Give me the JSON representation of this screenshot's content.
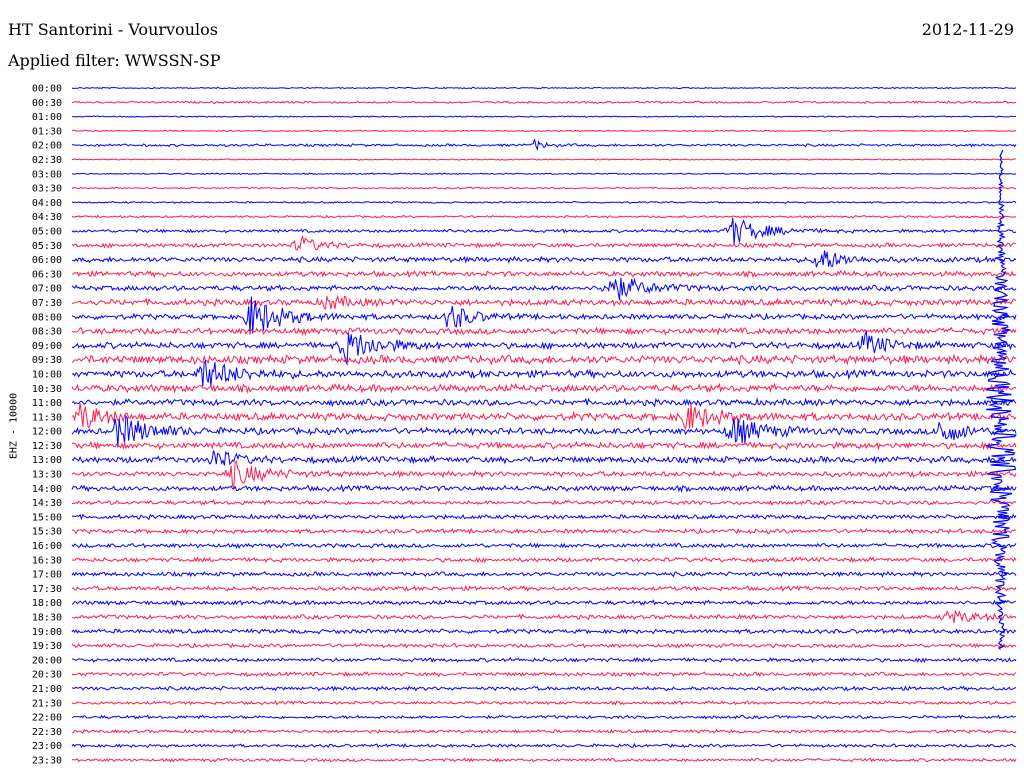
{
  "header": {
    "station": "HT Santorini - Vourvoulos",
    "date": "2012-11-29",
    "filter": "Applied filter: WWSSN-SP"
  },
  "chart_data": {
    "type": "line",
    "ylabel": "EHZ - 10000",
    "colors": [
      "#0000ff",
      "#ff1a50"
    ],
    "rows": [
      "00:00",
      "00:30",
      "01:00",
      "01:30",
      "02:00",
      "02:30",
      "03:00",
      "03:30",
      "04:00",
      "04:30",
      "05:00",
      "05:30",
      "06:00",
      "06:30",
      "07:00",
      "07:30",
      "08:00",
      "08:30",
      "09:00",
      "09:30",
      "10:00",
      "10:30",
      "11:00",
      "11:30",
      "12:00",
      "12:30",
      "13:00",
      "13:30",
      "14:00",
      "14:30",
      "15:00",
      "15:30",
      "16:00",
      "16:30",
      "17:00",
      "17:30",
      "18:00",
      "18:30",
      "19:00",
      "19:30",
      "20:00",
      "20:30",
      "21:00",
      "21:30",
      "22:00",
      "22:30",
      "23:00",
      "23:30"
    ],
    "noise": [
      0.6,
      1,
      0.6,
      0.6,
      1.2,
      0.6,
      0.6,
      0.8,
      0.8,
      1,
      1.5,
      2,
      2.5,
      2.5,
      2.5,
      3,
      2.5,
      3,
      3,
      4,
      3.5,
      3.5,
      3,
      3.5,
      3,
      3,
      3,
      2.5,
      2.5,
      2,
      2,
      2,
      2,
      2,
      2,
      2,
      2,
      2,
      2,
      1.8,
      1.8,
      1.8,
      1.8,
      1.5,
      1.5,
      1.5,
      1.5,
      1.5
    ],
    "events": [
      {
        "row": 4,
        "x": 0.49,
        "amp": 5,
        "width": 0.01
      },
      {
        "row": 10,
        "x": 0.7,
        "amp": 14,
        "width": 0.03
      },
      {
        "row": 11,
        "x": 0.24,
        "amp": 9,
        "width": 0.02
      },
      {
        "row": 12,
        "x": 0.79,
        "amp": 14,
        "width": 0.02
      },
      {
        "row": 14,
        "x": 0.57,
        "amp": 14,
        "width": 0.03
      },
      {
        "row": 15,
        "x": 0.27,
        "amp": 7,
        "width": 0.02
      },
      {
        "row": 16,
        "x": 0.19,
        "amp": 20,
        "width": 0.03
      },
      {
        "row": 16,
        "x": 0.4,
        "amp": 14,
        "width": 0.02
      },
      {
        "row": 18,
        "x": 0.29,
        "amp": 16,
        "width": 0.03
      },
      {
        "row": 18,
        "x": 0.84,
        "amp": 12,
        "width": 0.02
      },
      {
        "row": 20,
        "x": 0.14,
        "amp": 14,
        "width": 0.03
      },
      {
        "row": 23,
        "x": 0.01,
        "amp": 14,
        "width": 0.02
      },
      {
        "row": 23,
        "x": 0.65,
        "amp": 13,
        "width": 0.03
      },
      {
        "row": 24,
        "x": 0.05,
        "amp": 16,
        "width": 0.03
      },
      {
        "row": 24,
        "x": 0.7,
        "amp": 14,
        "width": 0.03
      },
      {
        "row": 24,
        "x": 0.92,
        "amp": 14,
        "width": 0.02
      },
      {
        "row": 26,
        "x": 0.15,
        "amp": 10,
        "width": 0.02
      },
      {
        "row": 27,
        "x": 0.17,
        "amp": 12,
        "width": 0.03
      },
      {
        "row": 37,
        "x": 0.93,
        "amp": 6,
        "width": 0.03
      }
    ]
  }
}
